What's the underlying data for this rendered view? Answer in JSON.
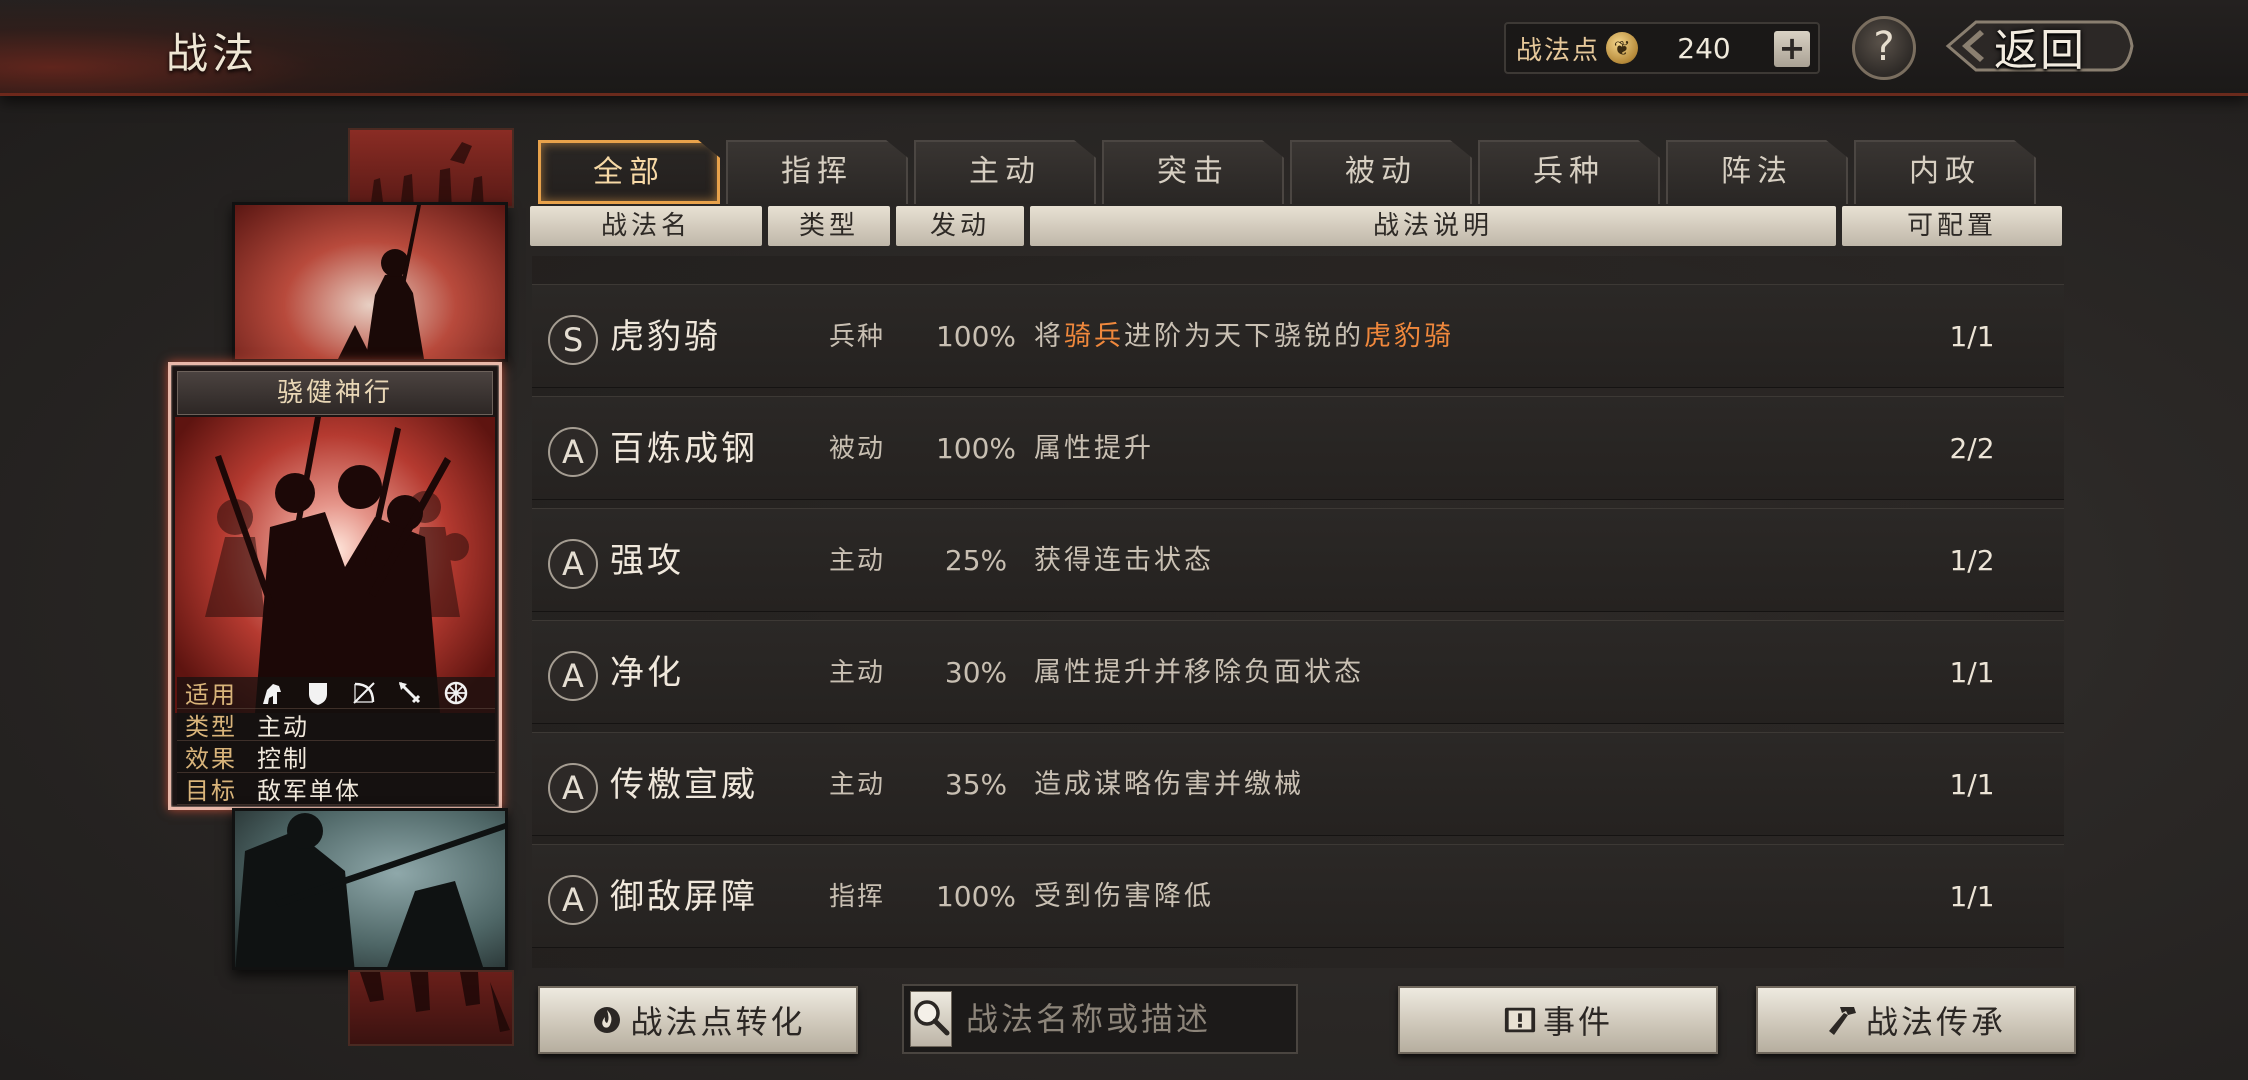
{
  "header": {
    "title": "战法",
    "points_label": "战法点",
    "points_value": "240",
    "add_label": "+",
    "help_label": "?",
    "back_label": "返回"
  },
  "skill_card": {
    "title": "骁健神行",
    "rows": [
      {
        "key": "适用",
        "value": ""
      },
      {
        "key": "类型",
        "value": "主动"
      },
      {
        "key": "效果",
        "value": "控制"
      },
      {
        "key": "目标",
        "value": "敌军单体"
      }
    ],
    "unit_icons": [
      "cavalry-icon",
      "shield-icon",
      "archer-icon",
      "spear-icon",
      "siege-wheel-icon"
    ]
  },
  "tabs": [
    "全部",
    "指挥",
    "主动",
    "突击",
    "被动",
    "兵种",
    "阵法",
    "内政"
  ],
  "active_tab": 0,
  "columns": {
    "name": "战法名",
    "type": "类型",
    "rate": "发动",
    "desc": "战法说明",
    "config": "可配置"
  },
  "rows": [
    {
      "grade": "S",
      "name": "虎豹骑",
      "type": "兵种",
      "rate": "100%",
      "desc_parts": [
        "将",
        "骑兵",
        "进阶为天下骁锐的",
        "虎豹骑"
      ],
      "config": "1/1"
    },
    {
      "grade": "A",
      "name": "百炼成钢",
      "type": "被动",
      "rate": "100%",
      "desc": "属性提升",
      "config": "2/2"
    },
    {
      "grade": "A",
      "name": "强攻",
      "type": "主动",
      "rate": "25%",
      "desc": "获得连击状态",
      "config": "1/2"
    },
    {
      "grade": "A",
      "name": "净化",
      "type": "主动",
      "rate": "30%",
      "desc": "属性提升并移除负面状态",
      "config": "1/1"
    },
    {
      "grade": "A",
      "name": "传檄宣威",
      "type": "主动",
      "rate": "35%",
      "desc": "造成谋略伤害并缴械",
      "config": "1/1"
    },
    {
      "grade": "A",
      "name": "御敌屏障",
      "type": "指挥",
      "rate": "100%",
      "desc": "受到伤害降低",
      "config": "1/1"
    }
  ],
  "bottom": {
    "convert_label": "战法点转化",
    "search_placeholder": "战法名称或描述",
    "event_label": "事件",
    "inherit_label": "战法传承"
  },
  "colors": {
    "accent_tab": "#e8a24b",
    "highlight_text": "#f0883c",
    "card_glow": "#b44a35"
  }
}
